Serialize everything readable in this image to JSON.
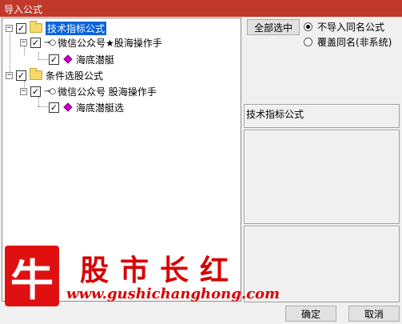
{
  "window": {
    "title": "导入公式"
  },
  "tree": {
    "group1": {
      "label": "技术指标公式",
      "checked": true
    },
    "author1": {
      "label": "微信公众号★股海操作手",
      "checked": true
    },
    "formula1": {
      "label": "海底潜艇",
      "checked": true
    },
    "group2": {
      "label": "条件选股公式",
      "checked": true
    },
    "author2": {
      "label": "微信公众号 股海操作手",
      "checked": true
    },
    "formula2": {
      "label": "海底潜艇选",
      "checked": true
    }
  },
  "controls": {
    "select_all": "全部选中",
    "radio_no_import": "不导入同名公式",
    "radio_overwrite": "覆盖同名(非系统)",
    "selected_radio": "no_import"
  },
  "info": {
    "panel_title": "技术指标公式"
  },
  "watermark": {
    "logo_char": "牛",
    "brand": "股市长红",
    "url": "www.gushichanghong.com"
  },
  "footer": {
    "ok": "确定",
    "cancel": "取消"
  },
  "colors": {
    "titlebar": "#c0392b",
    "selection": "#0a63d8",
    "watermark": "#d80000"
  }
}
